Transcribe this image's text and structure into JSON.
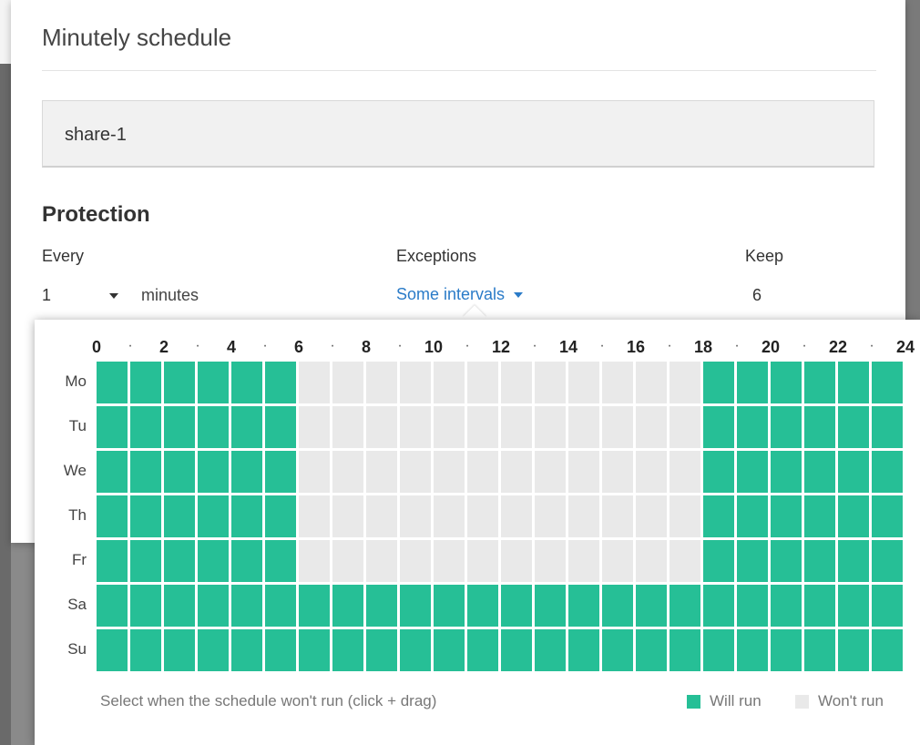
{
  "dialog": {
    "title": "Minutely schedule",
    "name_value": "share-1",
    "section_title": "Protection",
    "columns": {
      "every": "Every",
      "exceptions": "Exceptions",
      "keep": "Keep"
    },
    "every_value": "1",
    "every_unit": "minutes",
    "exceptions_value": "Some intervals",
    "keep_value": "6"
  },
  "schedule": {
    "hour_labels": [
      "0",
      "2",
      "4",
      "6",
      "8",
      "10",
      "12",
      "14",
      "16",
      "18",
      "20",
      "22",
      "24"
    ],
    "separator": "·",
    "days": [
      "Mo",
      "Tu",
      "We",
      "Th",
      "Fr",
      "Sa",
      "Su"
    ],
    "runs": [
      [
        1,
        1,
        1,
        1,
        1,
        1,
        0,
        0,
        0,
        0,
        0,
        0,
        0,
        0,
        0,
        0,
        0,
        0,
        1,
        1,
        1,
        1,
        1,
        1
      ],
      [
        1,
        1,
        1,
        1,
        1,
        1,
        0,
        0,
        0,
        0,
        0,
        0,
        0,
        0,
        0,
        0,
        0,
        0,
        1,
        1,
        1,
        1,
        1,
        1
      ],
      [
        1,
        1,
        1,
        1,
        1,
        1,
        0,
        0,
        0,
        0,
        0,
        0,
        0,
        0,
        0,
        0,
        0,
        0,
        1,
        1,
        1,
        1,
        1,
        1
      ],
      [
        1,
        1,
        1,
        1,
        1,
        1,
        0,
        0,
        0,
        0,
        0,
        0,
        0,
        0,
        0,
        0,
        0,
        0,
        1,
        1,
        1,
        1,
        1,
        1
      ],
      [
        1,
        1,
        1,
        1,
        1,
        1,
        0,
        0,
        0,
        0,
        0,
        0,
        0,
        0,
        0,
        0,
        0,
        0,
        1,
        1,
        1,
        1,
        1,
        1
      ],
      [
        1,
        1,
        1,
        1,
        1,
        1,
        1,
        1,
        1,
        1,
        1,
        1,
        1,
        1,
        1,
        1,
        1,
        1,
        1,
        1,
        1,
        1,
        1,
        1
      ],
      [
        1,
        1,
        1,
        1,
        1,
        1,
        1,
        1,
        1,
        1,
        1,
        1,
        1,
        1,
        1,
        1,
        1,
        1,
        1,
        1,
        1,
        1,
        1,
        1
      ]
    ],
    "help_text": "Select when the schedule won't run (click + drag)",
    "legend": {
      "will_run": "Will run",
      "wont_run": "Won't run"
    },
    "colors": {
      "will_run": "#26bf96",
      "wont_run": "#e9e9e9"
    }
  }
}
